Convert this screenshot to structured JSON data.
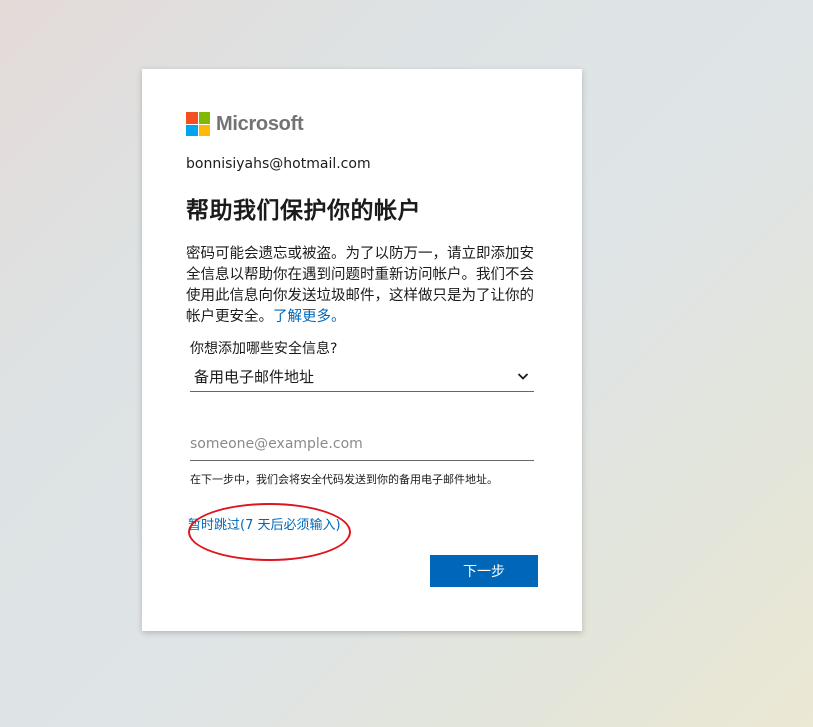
{
  "brand": {
    "name": "Microsoft",
    "logo_colors": [
      "#f25022",
      "#7fba00",
      "#00a4ef",
      "#ffb900"
    ]
  },
  "identity": "bonnisiyahs@hotmail.com",
  "title": "帮助我们保护你的帐户",
  "description": "密码可能会遗忘或被盗。为了以防万一，请立即添加安全信息以帮助你在遇到问题时重新访问帐户。我们不会使用此信息向你发送垃圾邮件，这样做只是为了让你的帐户更安全。",
  "learn_more": "了解更多。",
  "security_type": {
    "label": "你想添加哪些安全信息?",
    "selected": "备用电子邮件地址",
    "icon": "chevron-down-icon"
  },
  "email_field": {
    "placeholder": "someone@example.com",
    "value": ""
  },
  "hint": "在下一步中，我们会将安全代码发送到你的备用电子邮件地址。",
  "skip_link": "暂时跳过(7 天后必须输入)",
  "next_button": "下一步",
  "colors": {
    "accent": "#0067b8",
    "annotation": "#e0141c"
  }
}
